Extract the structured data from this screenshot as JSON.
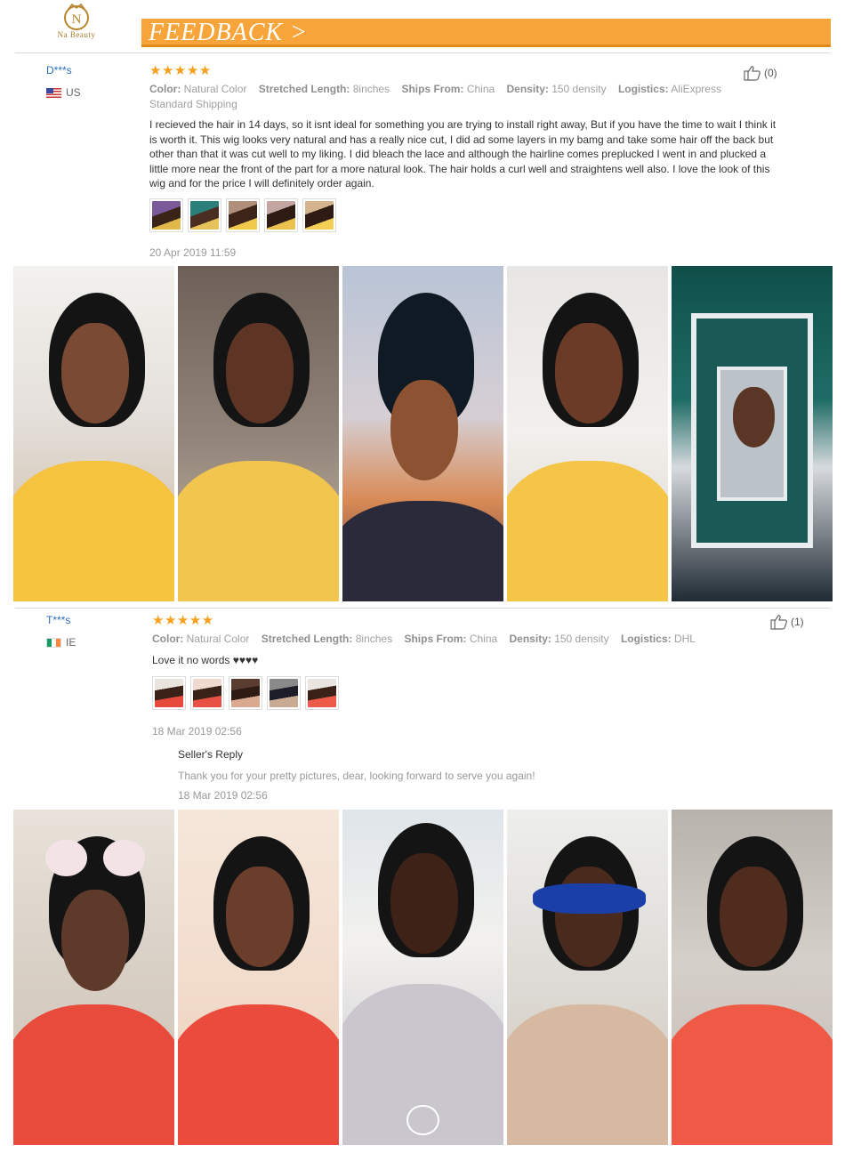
{
  "brand": {
    "logo_letter": "N",
    "logo_text": "Na Beauty"
  },
  "header": {
    "title": "FEEDBACK >"
  },
  "reviews": [
    {
      "name": "D***s",
      "country": "US",
      "rating": "★★★★★",
      "helpful_count": "(0)",
      "meta": {
        "color_label": "Color:",
        "color_value": "Natural Color",
        "length_label": "Stretched Length:",
        "length_value": "8inches",
        "ships_label": "Ships From:",
        "ships_value": "China",
        "density_label": "Density:",
        "density_value": "150 density",
        "logistics_label": "Logistics:",
        "logistics_value": "AliExpress Standard Shipping"
      },
      "text": "I recieved the hair in 14 days, so it isnt ideal for something you are trying to install right away, But if you have the time to wait I think it is worth it. This wig looks very natural and has a really nice cut, I did ad some layers in my bamg and take some hair off the back but other than that it was cut well to my liking. I did bleach the lace and although the hairline comes preplucked I went in and plucked a little more near the front of the part for a more natural look. The hair holds a curl well and straightens well also. I love the look of this wig and for the price I will definitely order again.",
      "date": "20 Apr 2019 11:59"
    },
    {
      "name": "T***s",
      "country": "IE",
      "rating": "★★★★★",
      "helpful_count": "(1)",
      "meta": {
        "color_label": "Color:",
        "color_value": "Natural Color",
        "length_label": "Stretched Length:",
        "length_value": "8inches",
        "ships_label": "Ships From:",
        "ships_value": "China",
        "density_label": "Density:",
        "density_value": "150 density",
        "logistics_label": "Logistics:",
        "logistics_value": "DHL"
      },
      "text": "Love it no words ♥♥♥♥",
      "date": "18 Mar 2019 02:56",
      "reply": {
        "title": "Seller's Reply",
        "text": "Thank you for your pretty pictures, dear, looking forward to serve you again!",
        "date": "18 Mar 2019 02:56"
      }
    }
  ],
  "colors": {
    "banner": "#f7a53b",
    "star": "#f7a01c",
    "name_link": "#2a6ebb"
  },
  "icons": [
    "like-icon",
    "star-icon",
    "flag-us-icon",
    "flag-ie-icon"
  ]
}
